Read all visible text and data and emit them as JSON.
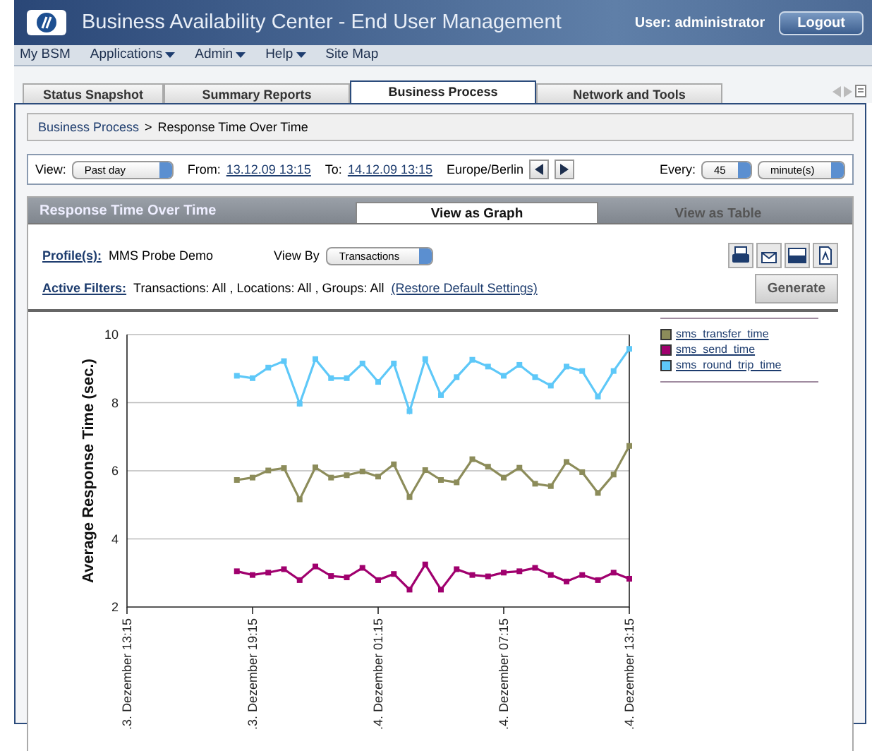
{
  "header": {
    "title": "Business Availability Center - End User Management",
    "user": "User: administrator",
    "logout": "Logout"
  },
  "menu": [
    {
      "label": "My BSM",
      "dropdown": false
    },
    {
      "label": "Applications",
      "dropdown": true
    },
    {
      "label": "Admin",
      "dropdown": true
    },
    {
      "label": "Help",
      "dropdown": true
    },
    {
      "label": "Site Map",
      "dropdown": false
    }
  ],
  "tabs": [
    {
      "label": "Status Snapshot",
      "selected": false
    },
    {
      "label": "Summary Reports",
      "selected": false
    },
    {
      "label": "Business Process",
      "selected": true
    },
    {
      "label": "Network and Tools",
      "selected": false
    }
  ],
  "breadcrumb": {
    "items": [
      "Business Process",
      "Response Time Over Time"
    ],
    "separator": ">"
  },
  "filters": {
    "view_label": "View:",
    "view_value": "Past day",
    "from_label": "From:",
    "from_value": "13.12.09 13:15",
    "to_label": "To:",
    "to_value": "14.12.09 13:15",
    "timezone": "Europe/Berlin",
    "every_label": "Every:",
    "every_value": "45",
    "unit_value": "minute(s)"
  },
  "report": {
    "title": "Response Time Over Time",
    "view_tabs": [
      {
        "label": "View as Graph",
        "selected": true
      },
      {
        "label": "View as Table",
        "selected": false
      }
    ],
    "profile_label": "Profile(s):",
    "profile_value": "MMS Probe Demo",
    "view_by_label": "View By",
    "view_by_value": "Transactions",
    "active_filters_label": "Active Filters:",
    "filters_text": "Transactions: All , Locations: All , Groups: All",
    "restore_link": "(Restore Default Settings)",
    "generate_button": "Generate",
    "chart_data": {
      "type": "line",
      "grid": true,
      "ylabel": "Average Response Time (sec.)",
      "ylim": [
        2,
        10
      ],
      "yticks": [
        2,
        4,
        6,
        8,
        10
      ],
      "categories": [
        ".3. Dezember 13:15",
        null,
        null,
        null,
        null,
        null,
        null,
        null,
        ".3. Dezember 19:15",
        null,
        null,
        null,
        null,
        null,
        null,
        null,
        ".4. Dezember 01:15",
        null,
        null,
        null,
        null,
        null,
        null,
        null,
        ".4. Dezember 07:15",
        null,
        null,
        null,
        null,
        null,
        null,
        null,
        ".4. Dezember 13:15"
      ],
      "series": [
        {
          "name": "sms_transfer_time",
          "color": "#8c8c5a",
          "marker": "square",
          "values": [
            null,
            null,
            null,
            null,
            null,
            null,
            null,
            5.73,
            5.8,
            6.01,
            6.08,
            5.16,
            6.1,
            5.8,
            5.87,
            5.98,
            5.83,
            6.19,
            5.23,
            6.02,
            5.73,
            5.66,
            6.34,
            6.12,
            5.8,
            6.09,
            5.62,
            5.55,
            6.26,
            5.96,
            5.35,
            5.89,
            6.73
          ]
        },
        {
          "name": "sms_send_time",
          "color": "#a0006e",
          "marker": "square",
          "values": [
            null,
            null,
            null,
            null,
            null,
            null,
            null,
            3.05,
            2.94,
            3.01,
            3.11,
            2.79,
            3.19,
            2.91,
            2.87,
            3.15,
            2.79,
            2.97,
            2.51,
            3.25,
            2.51,
            3.11,
            2.94,
            2.9,
            3.01,
            3.05,
            3.15,
            2.94,
            2.75,
            2.94,
            2.79,
            3.01,
            2.83
          ]
        },
        {
          "name": "sms_round_trip_time",
          "color": "#5ec8f8",
          "marker": "square",
          "values": [
            null,
            null,
            null,
            null,
            null,
            null,
            null,
            8.79,
            8.72,
            9.03,
            9.22,
            7.97,
            9.28,
            8.72,
            8.72,
            9.15,
            8.61,
            9.15,
            7.75,
            9.28,
            8.22,
            8.75,
            9.26,
            9.06,
            8.79,
            9.11,
            8.75,
            8.5,
            9.06,
            8.93,
            8.18,
            8.93,
            9.58
          ]
        }
      ]
    }
  }
}
